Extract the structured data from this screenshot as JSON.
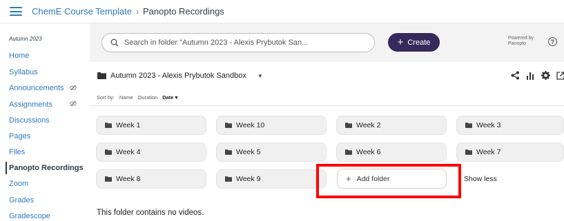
{
  "breadcrumb": {
    "course": "ChemE Course Template",
    "separator": "›",
    "current": "Panopto Recordings"
  },
  "sidebar": {
    "term": "Autumn 2023",
    "items": [
      {
        "label": "Home",
        "hidden": false
      },
      {
        "label": "Syllabus",
        "hidden": false
      },
      {
        "label": "Announcements",
        "hidden": true
      },
      {
        "label": "Assignments",
        "hidden": true
      },
      {
        "label": "Discussions",
        "hidden": false
      },
      {
        "label": "Pages",
        "hidden": false
      },
      {
        "label": "Files",
        "hidden": false
      },
      {
        "label": "Panopto Recordings",
        "hidden": false,
        "active": true
      },
      {
        "label": "Zoom",
        "hidden": false
      },
      {
        "label": "Grades",
        "hidden": false
      },
      {
        "label": "Gradescope",
        "hidden": false
      }
    ]
  },
  "panopto": {
    "search_placeholder": "Search in folder \"Autumn 2023 - Alexis Prybutok San...",
    "create_label": "Create",
    "powered_by": "Powered by",
    "powered_brand": "Panopto",
    "help": "?",
    "folder_name": "Autumn 2023 - Alexis Prybutok Sandbox",
    "sort": {
      "label": "Sort by:",
      "options": [
        "Name",
        "Duration",
        "Date ▾"
      ],
      "active": "Date ▾"
    },
    "folders": [
      "Week 1",
      "Week 10",
      "Week 2",
      "Week 3",
      "Week 4",
      "Week 5",
      "Week 6",
      "Week 7",
      "Week 8",
      "Week 9"
    ],
    "add_folder_label": "Add folder",
    "show_less_label": "Show less",
    "empty_message": "This folder contains no videos."
  },
  "colors": {
    "link": "#2b7abc",
    "create_button": "#352a5c",
    "highlight_box": "#ff0000"
  }
}
